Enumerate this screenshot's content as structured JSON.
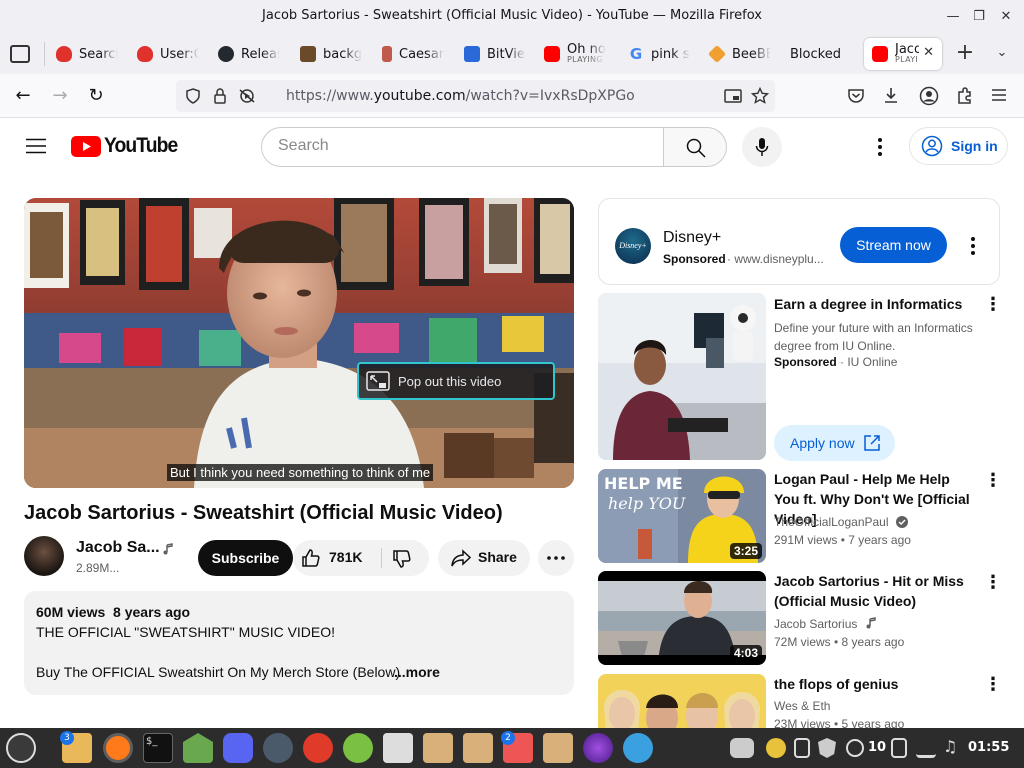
{
  "window": {
    "title": "Jacob Sartorius - Sweatshirt (Official Music Video) - YouTube — Mozilla Firefox"
  },
  "tabs": [
    {
      "label": "Search",
      "favicon": "#e0312d"
    },
    {
      "label": "User:C",
      "favicon": "#e0312d"
    },
    {
      "label": "Releas",
      "favicon": "#24292f"
    },
    {
      "label": "backgr",
      "favicon": "#6a4a2a"
    },
    {
      "label": "Caesar",
      "favicon": "#b55"
    },
    {
      "label": "BitVie",
      "favicon": "#2a6ad8"
    },
    {
      "label": "Oh no",
      "sublabel": "PLAYING",
      "favicon": "#ff0000"
    },
    {
      "label": "pink sl",
      "favicon": "#4285f4"
    },
    {
      "label": "BeeBE",
      "favicon": "#f0a030"
    },
    {
      "label": "Blocked",
      "favicon": ""
    },
    {
      "label": "Jaco",
      "sublabel": "PLAYI",
      "favicon": "#ff0000"
    }
  ],
  "urlbar": {
    "prefix": "https://www.",
    "domain": "youtube.com",
    "path": "/watch?v=IvxRsDpXPGo"
  },
  "youtube": {
    "logo_text": "YouTube",
    "search_placeholder": "Search",
    "signin_label": "Sign in",
    "subtitle": "But I think you need something to think of me",
    "popout_label": "Pop out this video",
    "video_title": "Jacob Sartorius - Sweatshirt (Official Music Video)",
    "channel_name": "Jacob Sa...",
    "channel_subs": "2.89M...",
    "subscribe_label": "Subscribe",
    "likes": "781K",
    "share_label": "Share",
    "desc_stats": "60M views  8 years ago",
    "desc_line1": "THE OFFICIAL \"SWEATSHIRT\" MUSIC VIDEO!",
    "desc_line2": "Buy The OFFICIAL Sweatshirt On My Merch Store (Below)",
    "desc_more": "...more"
  },
  "ads": {
    "disney": {
      "name": "Disney+",
      "sponsored": "Sponsored",
      "url": "www.disneyplu...",
      "cta": "Stream now",
      "logo_text": "Disney+"
    },
    "iu": {
      "title": "Earn a degree in Informatics",
      "desc": "Define your future with an Informatics degree from IU Online.",
      "sponsored": "Sponsored",
      "advertiser": "IU Online",
      "cta": "Apply now"
    }
  },
  "recommended": [
    {
      "title": "Logan Paul - Help Me Help You ft. Why Don't We [Official Video]",
      "channel": "TheOfficialLoganPaul",
      "meta": "291M views • 7 years ago",
      "duration": "3:25",
      "thumb_text_1": "HELP ME",
      "thumb_text_2": "help YOU"
    },
    {
      "title": "Jacob Sartorius - Hit or Miss (Official Music Video)",
      "channel": "Jacob Sartorius",
      "meta": "72M views • 8 years ago",
      "duration": "4:03"
    },
    {
      "title": "the flops of genius",
      "channel": "Wes & Eth",
      "meta": "23M views • 5 years ago"
    }
  ],
  "taskbar": {
    "clock": "01:55",
    "volume": "10",
    "badge_files": "3",
    "badge_mario": "2"
  },
  "colors": {
    "yt_red": "#ff0000",
    "link_blue": "#065fd4",
    "cta_blue": "#065fd4",
    "focus_ring": "#31c5d0"
  }
}
